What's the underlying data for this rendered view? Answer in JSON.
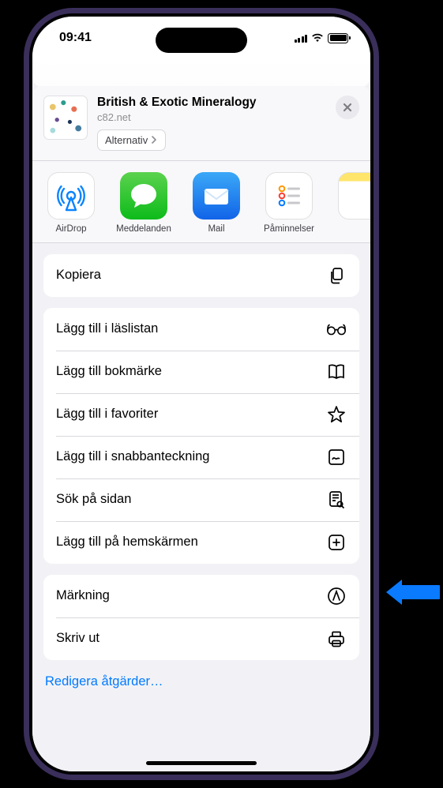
{
  "status": {
    "time": "09:41"
  },
  "share": {
    "title": "British & Exotic Mineralogy",
    "domain": "c82.net",
    "options_label": "Alternativ"
  },
  "apps": {
    "airdrop": "AirDrop",
    "messages": "Meddelanden",
    "mail": "Mail",
    "reminders": "Påminnelser"
  },
  "actions": {
    "copy": "Kopiera",
    "reading_list": "Lägg till i läslistan",
    "bookmark": "Lägg till bokmärke",
    "favorites": "Lägg till i favoriter",
    "quick_note": "Lägg till i snabbanteckning",
    "find_on_page": "Sök på sidan",
    "home_screen": "Lägg till på hemskärmen",
    "markup": "Märkning",
    "print": "Skriv ut"
  },
  "edit_actions": "Redigera åtgärder…"
}
